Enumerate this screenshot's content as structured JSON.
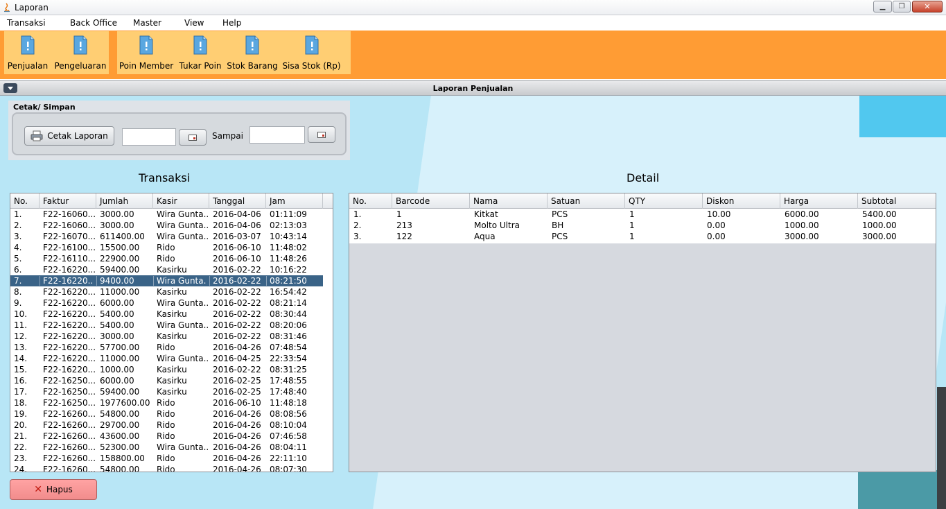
{
  "window": {
    "title": "Laporan",
    "controls": {
      "minimize": "▁",
      "maximize": "❐",
      "close": "✕"
    }
  },
  "menubar": [
    "Transaksi",
    "Back Office",
    "Master",
    "View",
    "Help"
  ],
  "toolbar": {
    "group1": [
      "Penjualan",
      "Pengeluaran"
    ],
    "group2": [
      "Poin Member",
      "Tukar Poin",
      "Stok Barang",
      "Sisa Stok (Rp)"
    ],
    "icon": "document-icon"
  },
  "frame": {
    "title": "Laporan Penjualan"
  },
  "cetak": {
    "title": "Cetak/ Simpan",
    "cetak_button": "Cetak Laporan",
    "date_from": "",
    "sampai_label": "Sampai",
    "date_to": ""
  },
  "transaksi": {
    "heading": "Transaksi",
    "columns": [
      "No.",
      "Faktur",
      "Jumlah",
      "Kasir",
      "Tanggal",
      "Jam"
    ],
    "selected_row": 6,
    "rows": [
      [
        "1.",
        "F22-16060...",
        "3000.00",
        "Wira Gunta...",
        "2016-04-06",
        "01:11:09"
      ],
      [
        "2.",
        "F22-16060...",
        "3000.00",
        "Wira Gunta...",
        "2016-04-06",
        "02:13:03"
      ],
      [
        "3.",
        "F22-16070...",
        "611400.00",
        "Wira Gunta...",
        "2016-03-07",
        "10:43:14"
      ],
      [
        "4.",
        "F22-16100...",
        "15500.00",
        "Rido",
        "2016-06-10",
        "11:48:02"
      ],
      [
        "5.",
        "F22-16110...",
        "22900.00",
        "Rido",
        "2016-06-10",
        "11:48:26"
      ],
      [
        "6.",
        "F22-16220...",
        "59400.00",
        "Kasirku",
        "2016-02-22",
        "10:16:22"
      ],
      [
        "7.",
        "F22-16220...",
        "9400.00",
        "Wira Gunta...",
        "2016-02-22",
        "08:21:50"
      ],
      [
        "8.",
        "F22-16220...",
        "11000.00",
        "Kasirku",
        "2016-02-22",
        "16:54:42"
      ],
      [
        "9.",
        "F22-16220...",
        "6000.00",
        "Wira Gunta...",
        "2016-02-22",
        "08:21:14"
      ],
      [
        "10.",
        "F22-16220...",
        "5400.00",
        "Kasirku",
        "2016-02-22",
        "08:30:44"
      ],
      [
        "11.",
        "F22-16220...",
        "5400.00",
        "Wira Gunta...",
        "2016-02-22",
        "08:20:06"
      ],
      [
        "12.",
        "F22-16220...",
        "3000.00",
        "Kasirku",
        "2016-02-22",
        "08:31:46"
      ],
      [
        "13.",
        "F22-16220...",
        "57700.00",
        "Rido",
        "2016-04-26",
        "07:48:54"
      ],
      [
        "14.",
        "F22-16220...",
        "11000.00",
        "Wira Gunta...",
        "2016-04-25",
        "22:33:54"
      ],
      [
        "15.",
        "F22-16220...",
        "1000.00",
        "Kasirku",
        "2016-02-22",
        "08:31:25"
      ],
      [
        "16.",
        "F22-16250...",
        "6000.00",
        "Kasirku",
        "2016-02-25",
        "17:48:55"
      ],
      [
        "17.",
        "F22-16250...",
        "59400.00",
        "Kasirku",
        "2016-02-25",
        "17:48:40"
      ],
      [
        "18.",
        "F22-16250...",
        "1977600.00",
        "Rido",
        "2016-06-10",
        "11:48:18"
      ],
      [
        "19.",
        "F22-16260...",
        "54800.00",
        "Rido",
        "2016-04-26",
        "08:08:56"
      ],
      [
        "20.",
        "F22-16260...",
        "29700.00",
        "Rido",
        "2016-04-26",
        "08:10:04"
      ],
      [
        "21.",
        "F22-16260...",
        "43600.00",
        "Rido",
        "2016-04-26",
        "07:46:58"
      ],
      [
        "22.",
        "F22-16260...",
        "52300.00",
        "Wira Gunta...",
        "2016-04-26",
        "08:04:11"
      ],
      [
        "23.",
        "F22-16260...",
        "158800.00",
        "Rido",
        "2016-04-26",
        "22:11:10"
      ],
      [
        "24.",
        "F22-16260...",
        "54800.00",
        "Rido",
        "2016-04-26",
        "08:07:30"
      ]
    ]
  },
  "detail": {
    "heading": "Detail",
    "columns": [
      "No.",
      "Barcode",
      "Nama",
      "Satuan",
      "QTY",
      "Diskon",
      "Harga",
      "Subtotal"
    ],
    "rows": [
      [
        "1.",
        "1",
        "Kitkat",
        "PCS",
        "1",
        "10.00",
        "6000.00",
        "5400.00"
      ],
      [
        "2.",
        "213",
        "Molto Ultra",
        "BH",
        "1",
        "0.00",
        "1000.00",
        "1000.00"
      ],
      [
        "3.",
        "122",
        "Aqua",
        "PCS",
        "1",
        "0.00",
        "3000.00",
        "3000.00"
      ]
    ]
  },
  "hapus_label": "Hapus",
  "colors": {
    "toolbar_bg": "#ff9c34",
    "toolbar_group": "#ffce73",
    "selected_row": "#3a6387",
    "hapus_bg": "#f28c8c"
  }
}
